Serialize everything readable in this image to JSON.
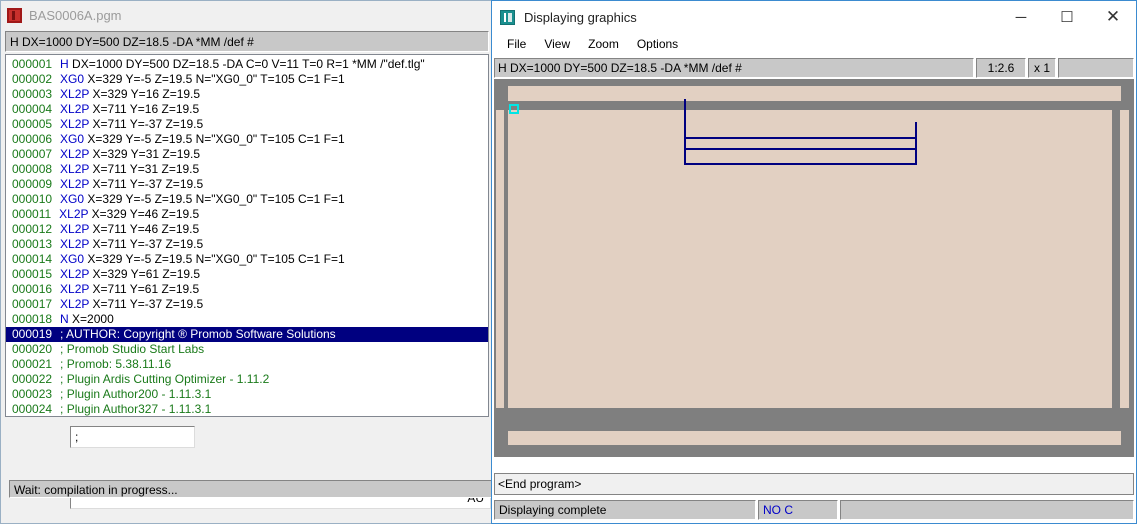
{
  "editor_window": {
    "icon": "pgm-file-icon",
    "title": "BAS0006A.pgm",
    "header_command": "H DX=1000 DY=500 DZ=18.5 -DA *MM /def #",
    "code_lines": [
      {
        "num": "000001",
        "kw": "H",
        "text": "DX=1000 DY=500 DZ=18.5 -DA C=0 V=11 T=0 R=1 *MM /\"def.tlg\"",
        "selected": false,
        "comment": false
      },
      {
        "num": "000002",
        "kw": "XG0",
        "text": "X=329 Y=-5 Z=19.5 N=\"XG0_0\" T=105 C=1 F=1",
        "selected": false,
        "comment": false
      },
      {
        "num": "000003",
        "kw": "XL2P",
        "text": "X=329 Y=16 Z=19.5",
        "selected": false,
        "comment": false
      },
      {
        "num": "000004",
        "kw": "XL2P",
        "text": "X=711 Y=16 Z=19.5",
        "selected": false,
        "comment": false
      },
      {
        "num": "000005",
        "kw": "XL2P",
        "text": "X=711 Y=-37 Z=19.5",
        "selected": false,
        "comment": false
      },
      {
        "num": "000006",
        "kw": "XG0",
        "text": "X=329 Y=-5 Z=19.5 N=\"XG0_0\" T=105 C=1 F=1",
        "selected": false,
        "comment": false
      },
      {
        "num": "000007",
        "kw": "XL2P",
        "text": "X=329 Y=31 Z=19.5",
        "selected": false,
        "comment": false
      },
      {
        "num": "000008",
        "kw": "XL2P",
        "text": "X=711 Y=31 Z=19.5",
        "selected": false,
        "comment": false
      },
      {
        "num": "000009",
        "kw": "XL2P",
        "text": "X=711 Y=-37 Z=19.5",
        "selected": false,
        "comment": false
      },
      {
        "num": "000010",
        "kw": "XG0",
        "text": "X=329 Y=-5 Z=19.5 N=\"XG0_0\" T=105 C=1 F=1",
        "selected": false,
        "comment": false
      },
      {
        "num": "000011",
        "kw": "XL2P",
        "text": "X=329 Y=46 Z=19.5",
        "selected": false,
        "comment": false
      },
      {
        "num": "000012",
        "kw": "XL2P",
        "text": "X=711 Y=46 Z=19.5",
        "selected": false,
        "comment": false
      },
      {
        "num": "000013",
        "kw": "XL2P",
        "text": "X=711 Y=-37 Z=19.5",
        "selected": false,
        "comment": false
      },
      {
        "num": "000014",
        "kw": "XG0",
        "text": "X=329 Y=-5 Z=19.5 N=\"XG0_0\" T=105 C=1 F=1",
        "selected": false,
        "comment": false
      },
      {
        "num": "000015",
        "kw": "XL2P",
        "text": "X=329 Y=61 Z=19.5",
        "selected": false,
        "comment": false
      },
      {
        "num": "000016",
        "kw": "XL2P",
        "text": "X=711 Y=61 Z=19.5",
        "selected": false,
        "comment": false
      },
      {
        "num": "000017",
        "kw": "XL2P",
        "text": "X=711 Y=-37 Z=19.5",
        "selected": false,
        "comment": false
      },
      {
        "num": "000018",
        "kw": "N",
        "text": "X=2000",
        "selected": false,
        "comment": false
      },
      {
        "num": "000019",
        "kw": "",
        "text": "; AUTHOR: Copyright ® Promob Software Solutions",
        "selected": true,
        "comment": true
      },
      {
        "num": "000020",
        "kw": "",
        "text": "; Promob Studio Start Labs",
        "selected": false,
        "comment": true
      },
      {
        "num": "000021",
        "kw": "",
        "text": "; Promob: 5.38.11.16",
        "selected": false,
        "comment": true
      },
      {
        "num": "000022",
        "kw": "",
        "text": "; Plugin Ardis Cutting Optimizer - 1.11.2",
        "selected": false,
        "comment": true
      },
      {
        "num": "000023",
        "kw": "",
        "text": "; Plugin Author200 - 1.11.3.1",
        "selected": false,
        "comment": true
      },
      {
        "num": "000024",
        "kw": "",
        "text": "; Plugin Author327 - 1.11.3.1",
        "selected": false,
        "comment": true
      }
    ],
    "small_input_value": ";",
    "wide_input_value": "AU",
    "status_text": "Wait: compilation in progress..."
  },
  "graphics_window": {
    "icon": "graphics-app-icon",
    "title": "Displaying graphics",
    "window_buttons": {
      "minimize": "─",
      "maximize": "☐",
      "close": "✕"
    },
    "menu": [
      "File",
      "View",
      "Zoom",
      "Options"
    ],
    "toolbar": {
      "command": "H DX=1000 DY=500 DZ=18.5 -DA *MM /def #",
      "scale": "1:2.6",
      "multiplier": "x 1",
      "extra": ""
    },
    "message_bar": "<End program>",
    "status": {
      "main": "Displaying complete",
      "code": "NO C",
      "rest": ""
    },
    "colors": {
      "panel_beige": "#e2d0c2",
      "canvas_gray": "#7f7f7f",
      "toolpath_navy": "#000080",
      "cursor_cyan": "#00e5e5",
      "window_border": "#3b8bd0"
    }
  }
}
